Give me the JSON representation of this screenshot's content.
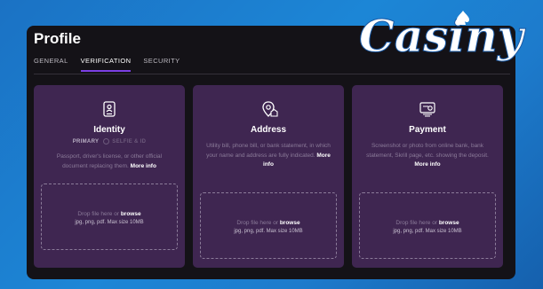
{
  "profile": {
    "title": "Profile"
  },
  "tabs": [
    {
      "label": "GENERAL"
    },
    {
      "label": "VERIFICATION"
    },
    {
      "label": "SECURITY"
    }
  ],
  "cards": [
    {
      "title": "Identity",
      "primary": "PRIMARY",
      "secondary": "SELFIE & ID",
      "desc": "Passport, driver's license, or other official document replacing them.",
      "link": "More info",
      "drop_text": "Drop file here or",
      "drop_link": "browse",
      "formats": "jpg, png, pdf. Max size 10MB",
      "icon": "id-card-icon"
    },
    {
      "title": "Address",
      "desc": "Utility bill, phone bill, or bank statement, in which your name and address are fully indicated.",
      "link": "More info",
      "drop_text": "Drop file here or",
      "drop_link": "browse",
      "formats": "jpg, png, pdf. Max size 10MB",
      "icon": "location-pin-icon"
    },
    {
      "title": "Payment",
      "desc": "Screenshot or photo from online bank, bank statement, Skrill page, etc. showing the deposit.",
      "link": "More info",
      "drop_text": "Drop file here or",
      "drop_link": "browse",
      "formats": "jpg, png, pdf. Max size 10MB",
      "icon": "payment-receipt-icon"
    }
  ],
  "brand": {
    "logo_text": "Casiny",
    "accent": "#7b3fe4",
    "card_bg": "#3f2651"
  }
}
